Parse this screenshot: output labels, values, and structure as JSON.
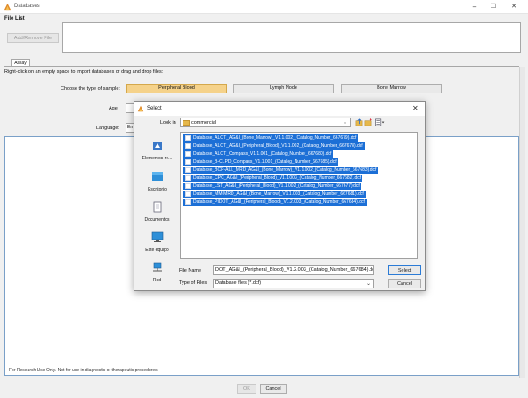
{
  "window": {
    "title": "Databases"
  },
  "file_list": {
    "label": "File List",
    "add_remove_button": "Add/Remove File"
  },
  "tabs": [
    {
      "label": "Assay"
    }
  ],
  "instructions": "Right-click on an empty space to import databases or drag and drop files:",
  "sample": {
    "label": "Choose the type of sample:",
    "options": [
      "Peripheral Blood",
      "Lymph Node",
      "Bone Marrow"
    ],
    "selected": "Peripheral Blood"
  },
  "age": {
    "label": "Age:"
  },
  "language": {
    "label": "Language:",
    "value": "En"
  },
  "footer_note": "For Research Use Only. Not for use in diagnostic or therapeutic procedures",
  "bottom_buttons": {
    "ok": "OK",
    "cancel": "Cancel"
  },
  "dialog": {
    "title": "Select",
    "look_in_label": "Look in",
    "look_in_value": "commercial",
    "places": [
      "Elementos re...",
      "Escritorio",
      "Documentos",
      "Este equipo",
      "Red"
    ],
    "files": [
      "Database_ALOT_AG&I_(Bone_Marrow)_V1.1.002_(Catalog_Number_667679).dcf",
      "Database_ALOT_AG&I_(Peripheral_Blood)_V1.1.002_(Catalog_Number_667678).dcf",
      "Database_ALOT_Compass_V1.1.001_(Catalog_Number_667680).dcf",
      "Database_B-CLPD_Compass_V1.1.001_(Catalog_Number_667685).dcf",
      "Database_BCP-ALL_MRD_AG&I_(Bone_Marrow)_V1.1.002_(Catalog_Number_667683).dcf",
      "Database_CPC_AG&I_(Peripheral_Blood)_V1.1.003_(Catalog_Number_667682).dcf",
      "Database_LST_AG&I_(Peripheral_Blood)_V1.1.002_(Catalog_Number_667677).dcf",
      "Database_MM-MRD_AG&I_(Bone_Marrow)_V1.1.003_(Catalog_Number_667681).dcf",
      "Database_PIDOT_AG&I_(Peripheral_Blood)_V1.2.003_(Catalog_Number_667684).dcf"
    ],
    "file_name_label": "File Name",
    "file_name_value": "DOT_AG&I_(Peripheral_Blood)_V1.2.003_(Catalog_Number_667684).dcf\"",
    "file_type_label": "Type of Files",
    "file_type_value": "Database files (*.dcf)",
    "select_button": "Select",
    "cancel_button": "Cancel"
  },
  "colors": {
    "selection": "#1c6fd6",
    "selected_sample": "#f5d28a"
  },
  "window_controls": {
    "minimize": "–",
    "maximize": "☐",
    "close": "✕"
  }
}
